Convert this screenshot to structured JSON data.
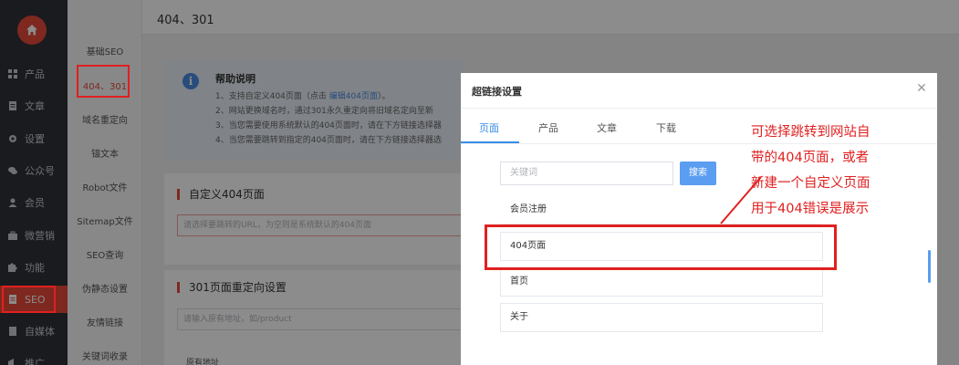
{
  "sidebar": {
    "logo_icon": "home-icon",
    "items": [
      {
        "label": "产品",
        "icon": "grid-icon"
      },
      {
        "label": "文章",
        "icon": "document-icon"
      },
      {
        "label": "设置",
        "icon": "gear-icon"
      },
      {
        "label": "公众号",
        "icon": "chat-icon"
      },
      {
        "label": "会员",
        "icon": "user-icon"
      },
      {
        "label": "微营销",
        "icon": "briefcase-icon"
      },
      {
        "label": "功能",
        "icon": "puzzle-icon"
      },
      {
        "label": "SEO",
        "icon": "seo-icon",
        "active": true
      },
      {
        "label": "自媒体",
        "icon": "media-icon"
      },
      {
        "label": "推广",
        "icon": "megaphone-icon"
      }
    ]
  },
  "subnav": {
    "items": [
      "基础SEO",
      "404、301",
      "域名重定向",
      "锚文本",
      "Robot文件",
      "Sitemap文件",
      "SEO查询",
      "伪静态设置",
      "友情链接",
      "关键词收录"
    ],
    "active_index": 1
  },
  "header": {
    "title": "404、301"
  },
  "help": {
    "title": "帮助说明",
    "lines": [
      "1、支持自定义404页面（点击",
      "2、网站更换域名时，通过301永久重定向将旧域名定向至新",
      "3、当您需要使用系统默认的404页面时，请在下方链接选择器",
      "4、当您需要跳转到指定的404页面时，请在下方链接选择器选"
    ],
    "link_text": "编辑404页面",
    "line1_tail": "）。"
  },
  "section404": {
    "title": "自定义404页面",
    "placeholder": "请选择要跳转的URL，为空则是系统默认的404页面"
  },
  "section301": {
    "title": "301页面重定向设置",
    "placeholder": "请输入原有地址，如/product",
    "table_header": "原有地址"
  },
  "modal": {
    "title": "超链接设置",
    "close_icon": "close-icon",
    "tabs": [
      "页面",
      "产品",
      "文章",
      "下载"
    ],
    "active_tab": 0,
    "search_placeholder": "关键词",
    "search_button": "搜索",
    "items": [
      "会员注册",
      "404页面",
      "首页",
      "关于"
    ]
  },
  "annotation": {
    "lines": [
      "可选择跳转到网站自",
      "带的404页面，或者",
      "新建一个自定义页面",
      "用于404错误是展示"
    ],
    "color": "#e02020"
  }
}
